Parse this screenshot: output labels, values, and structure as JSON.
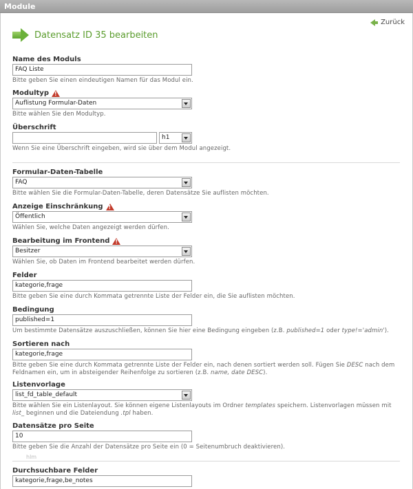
{
  "window": {
    "title": "Module"
  },
  "nav": {
    "back_label": "Zurück"
  },
  "page": {
    "title": "Datensatz ID 35 bearbeiten"
  },
  "fields": {
    "name": {
      "label": "Name des Moduls",
      "value": "FAQ Liste",
      "help": "Bitte geben Sie einen eindeutigen Namen für das Modul ein."
    },
    "type": {
      "label": "Modultyp",
      "value": "Auflistung Formular-Daten",
      "help": "Bitte wählen Sie den Modultyp."
    },
    "headline": {
      "label": "Überschrift",
      "value": "",
      "level": "h1",
      "help": "Wenn Sie eine Überschrift eingeben, wird sie über dem Modul angezeigt."
    },
    "table": {
      "label": "Formular-Daten-Tabelle",
      "value": "FAQ",
      "help": "Bitte wählen Sie die Formular-Daten-Tabelle, deren Datensätze Sie auflisten möchten."
    },
    "restriction": {
      "label": "Anzeige Einschränkung",
      "value": "Öffentlich",
      "help": "Wählen Sie, welche Daten angezeigt werden dürfen."
    },
    "frontend_edit": {
      "label": "Bearbeitung im Frontend",
      "value": "Besitzer",
      "help": "Wählen Sie, ob Daten im Frontend bearbeitet werden dürfen."
    },
    "felder": {
      "label": "Felder",
      "value": "kategorie,frage",
      "help": "Bitte geben Sie eine durch Kommata getrennte Liste der Felder ein, die Sie auflisten möchten."
    },
    "condition": {
      "label": "Bedingung",
      "value": "published=1",
      "help_pre": "Um bestimmte Datensätze auszuschließen, können Sie hier eine Bedingung eingeben (z.B. ",
      "help_ex1": "published=1",
      "help_mid": " oder ",
      "help_ex2": "type!='admin'",
      "help_post": ")."
    },
    "sort": {
      "label": "Sortieren nach",
      "value": "kategorie,frage",
      "help_pre": "Bitte geben Sie eine durch Kommata getrennte Liste der Felder ein, nach denen sortiert werden soll. Fügen Sie ",
      "help_ex1": "DESC",
      "help_mid": " nach dem Feldnamen ein, um in absteigender Reihenfolge zu sortieren (z.B. ",
      "help_ex2": "name, date DESC",
      "help_post": ")."
    },
    "template": {
      "label": "Listenvorlage",
      "value": "list_fd_table_default",
      "help_pre": "Bitte wählen Sie ein Listenlayout. Sie können eigene Listenlayouts im Ordner ",
      "help_ex1": "templates",
      "help_mid": " speichern. Listenvorlagen müssen mit ",
      "help_ex2": "list_",
      "help_mid2": " beginnen und die Dateiendung ",
      "help_ex3": ".tpl",
      "help_post": " haben."
    },
    "per_page": {
      "label": "Datensätze pro Seite",
      "value": "10",
      "help": "Bitte geben Sie die Anzahl der Datensätze pro Seite ein (0 = Seitenumbruch deaktivieren)."
    },
    "searchable": {
      "label": "Durchsuchbare Felder",
      "value": "kategorie,frage,be_notes"
    }
  },
  "ghost_text": "hlm"
}
